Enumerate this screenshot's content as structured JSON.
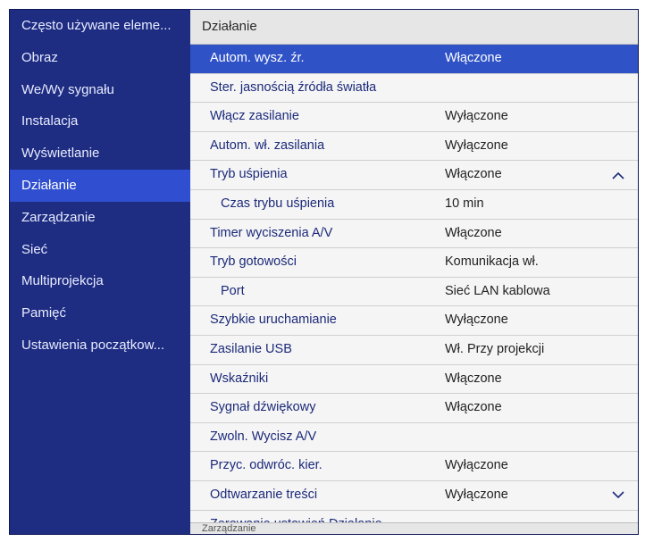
{
  "sidebar": {
    "items": [
      {
        "label": "Często używane eleme..."
      },
      {
        "label": "Obraz"
      },
      {
        "label": "We/Wy sygnału"
      },
      {
        "label": "Instalacja"
      },
      {
        "label": "Wyświetlanie"
      },
      {
        "label": "Działanie",
        "active": true
      },
      {
        "label": "Zarządzanie"
      },
      {
        "label": "Sieć"
      },
      {
        "label": "Multiprojekcja"
      },
      {
        "label": "Pamięć"
      },
      {
        "label": "Ustawienia początkow..."
      }
    ]
  },
  "panel": {
    "title": "Działanie",
    "rows": [
      {
        "label": "Autom. wysz. źr.",
        "value": "Włączone",
        "selected": true
      },
      {
        "label": "Ster. jasnością źródła światła",
        "value": ""
      },
      {
        "label": "Włącz zasilanie",
        "value": "Wyłączone"
      },
      {
        "label": "Autom. wł. zasilania",
        "value": "Wyłączone"
      },
      {
        "label": "Tryb uśpienia",
        "value": "Włączone",
        "scroll": "up"
      },
      {
        "label": "Czas trybu uśpienia",
        "value": "10 min",
        "sub": true
      },
      {
        "label": "Timer wyciszenia A/V",
        "value": "Włączone"
      },
      {
        "label": "Tryb gotowości",
        "value": "Komunikacja wł."
      },
      {
        "label": "Port",
        "value": "Sieć LAN kablowa",
        "sub": true
      },
      {
        "label": "Szybkie uruchamianie",
        "value": "Wyłączone"
      },
      {
        "label": "Zasilanie USB",
        "value": "Wł. Przy projekcji"
      },
      {
        "label": "Wskaźniki",
        "value": "Włączone"
      },
      {
        "label": "Sygnał dźwiękowy",
        "value": "Włączone"
      },
      {
        "label": "Zwoln. Wycisz A/V",
        "value": ""
      },
      {
        "label": "Przyc. odwróc. kier.",
        "value": "Wyłączone"
      },
      {
        "label": "Odtwarzanie treści",
        "value": "Wyłączone",
        "scroll": "down"
      },
      {
        "label": "Zerowanie ustawień Działanie",
        "value": ""
      }
    ],
    "footer": "Zarządzanie"
  },
  "colors": {
    "sidebar_bg": "#1e2c82",
    "active_item": "#2f4fd0",
    "selected_row": "#2f52c7",
    "row_text": "#1c2a7a"
  }
}
